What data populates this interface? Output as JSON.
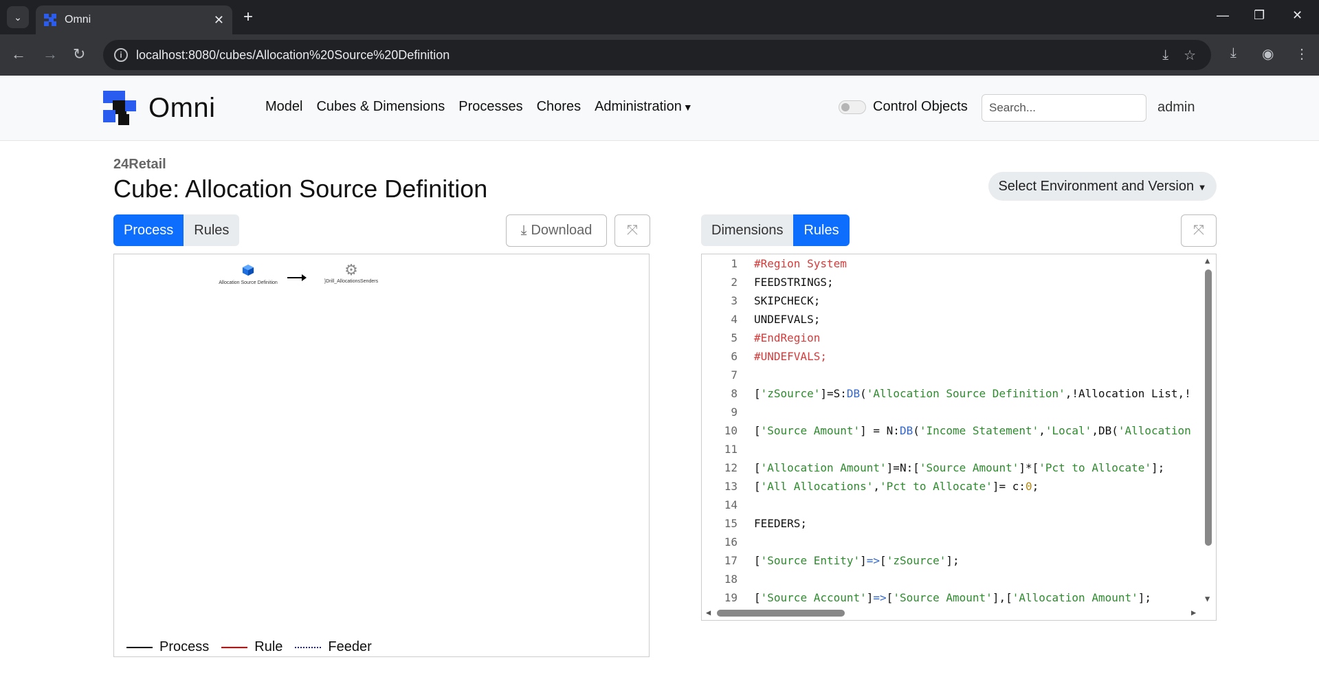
{
  "browser": {
    "tab_title": "Omni",
    "url": "localhost:8080/cubes/Allocation%20Source%20Definition"
  },
  "nav": {
    "brand": "Omni",
    "links": [
      "Model",
      "Cubes & Dimensions",
      "Processes",
      "Chores",
      "Administration"
    ],
    "control_objects_label": "Control Objects",
    "search_placeholder": "Search...",
    "user": "admin"
  },
  "header": {
    "environment": "24Retail",
    "title": "Cube: Allocation Source Definition",
    "env_version_button": "Select Environment and Version"
  },
  "left_panel": {
    "tabs": [
      "Process",
      "Rules"
    ],
    "active_tab": "Process",
    "download_label": "Download",
    "nodes": [
      {
        "label": "Allocation Source Definition",
        "icon": "cube-icon"
      },
      {
        "label": "}Drill_AllocationsSenders",
        "icon": "gear-icon"
      }
    ],
    "legend": [
      "Process",
      "Rule",
      "Feeder"
    ]
  },
  "right_panel": {
    "tabs": [
      "Dimensions",
      "Rules"
    ],
    "active_tab": "Rules",
    "code_lines": [
      "#Region System",
      "FEEDSTRINGS;",
      "SKIPCHECK;",
      "UNDEFVALS;",
      "#EndRegion",
      "#UNDEFVALS;",
      "",
      "['zSource']=S:DB('Allocation Source Definition',!Allocation List,!",
      "",
      "['Source Amount'] = N:DB('Income Statement','Local',DB('Allocation",
      "",
      "['Allocation Amount']=N:['Source Amount']*['Pct to Allocate'];",
      "['All Allocations','Pct to Allocate']= c:0;",
      "",
      "FEEDERS;",
      "",
      "['Source Entity']=>['zSource'];",
      "",
      "['Source Account']=>['Source Amount'],['Allocation Amount'];"
    ]
  },
  "colors": {
    "primary": "#0d6efd",
    "brand_blue": "#2b5cf0",
    "keyword": "#d63b3b",
    "string": "#2e8b2e",
    "function": "#3366cc",
    "rule_line": "#e00000",
    "feeder_line": "#1a1acc"
  }
}
